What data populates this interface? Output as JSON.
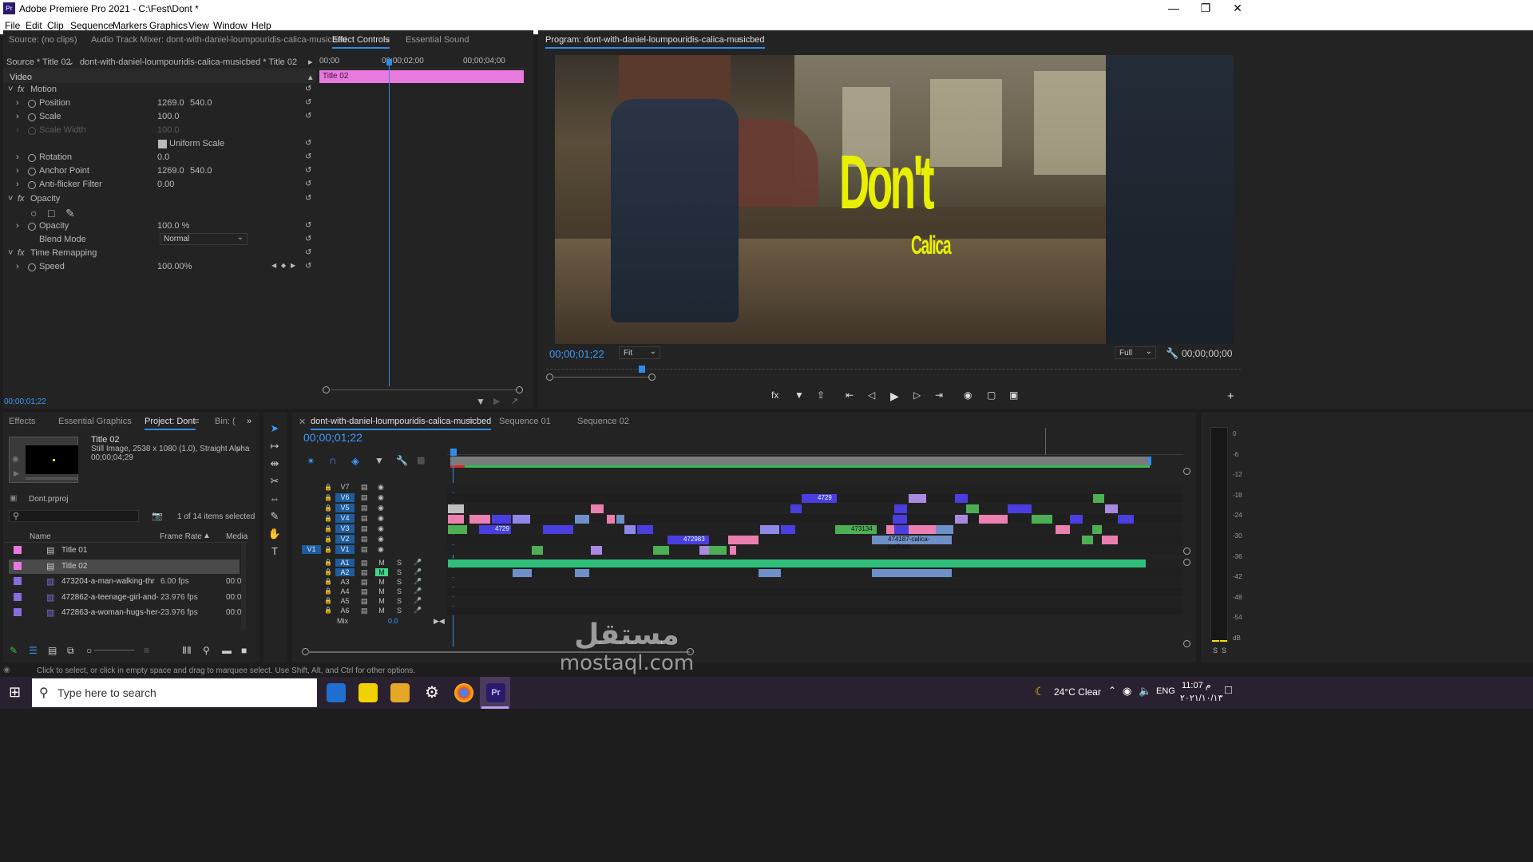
{
  "window": {
    "title": "Adobe Premiere Pro 2021 - C:\\Fest\\Dont *",
    "app_icon": "Pr",
    "controls": [
      "minimize-icon",
      "maximize-icon",
      "close-icon"
    ]
  },
  "menu": [
    "File",
    "Edit",
    "Clip",
    "Sequence",
    "Markers",
    "Graphics",
    "View",
    "Window",
    "Help"
  ],
  "top_left_tabs": {
    "source": "Source: (no clips)",
    "mixer": "Audio Track Mixer: dont-with-daniel-loumpouridis-calica-musicbed",
    "effect_controls": "Effect Controls",
    "essential_sound": "Essential Sound"
  },
  "effect_controls": {
    "source_label": "Source * Title 02",
    "seq_label": "dont-with-daniel-loumpouridis-calica-musicbed * Title 02",
    "ruler": [
      "00;00",
      "00;00;02;00",
      "00;00;04;00"
    ],
    "clip_name": "Title 02",
    "video_label": "Video",
    "timecode": "00;00;01;22",
    "rows": [
      {
        "name": "Motion",
        "fx": true
      },
      {
        "name": "Position",
        "v1": "1269.0",
        "v2": "540.0"
      },
      {
        "name": "Scale",
        "v1": "100.0"
      },
      {
        "name": "Scale Width",
        "v1": "100.0",
        "disabled": true
      },
      {
        "name": "Uniform Scale",
        "checkbox": true
      },
      {
        "name": "Rotation",
        "v1": "0.0"
      },
      {
        "name": "Anchor Point",
        "v1": "1269.0",
        "v2": "540.0"
      },
      {
        "name": "Anti-flicker Filter",
        "v1": "0.00"
      },
      {
        "name": "Opacity",
        "fx": true
      },
      {
        "name": "Opacity",
        "v1": "100.0 %"
      },
      {
        "name": "Blend Mode",
        "select": "Normal"
      },
      {
        "name": "Time Remapping",
        "fx": true
      },
      {
        "name": "Speed",
        "v1": "100.00%"
      }
    ]
  },
  "program": {
    "tab": "Program: dont-with-daniel-loumpouridis-calica-musicbed",
    "timecode_left": "00;00;01;22",
    "fit": "Fit",
    "quality": "Full",
    "timecode_right": "00;00;00;00",
    "title_text": "Don't",
    "subtitle_text": "Calica",
    "controls": [
      "fx-icon",
      "marker-icon",
      "lift-icon",
      "goto-in-icon",
      "step-back-icon",
      "play-icon",
      "step-forward-icon",
      "goto-out-icon",
      "camera-icon",
      "safe-margins-icon",
      "compare-icon",
      "add-icon"
    ]
  },
  "project": {
    "tabs": [
      "Effects",
      "Essential Graphics",
      "Project: Dont",
      "Bin: ("
    ],
    "preview_name": "Title 02",
    "preview_info": "Still Image, 2538 x 1080 (1.0), Straight Alpha",
    "preview_duration": "00;00;04;29",
    "file_name": "Dont.prproj",
    "selected_count": "1 of 14 items selected",
    "columns": [
      "Name",
      "Frame Rate",
      "Media"
    ],
    "items": [
      {
        "name": "Title 01",
        "fps": "",
        "media": "",
        "color": "#e87adf",
        "selected": false
      },
      {
        "name": "Title 02",
        "fps": "",
        "media": "",
        "color": "#e87adf",
        "selected": true
      },
      {
        "name": "473204-a-man-walking-thr",
        "fps": "6.00 fps",
        "media": "00:0",
        "color": "#8a6ce0",
        "selected": false
      },
      {
        "name": "472862-a-teenage-girl-and-",
        "fps": "23.976 fps",
        "media": "00:0",
        "color": "#8a6ce0",
        "selected": false
      },
      {
        "name": "472863-a-woman-hugs-her-",
        "fps": "23.976 fps",
        "media": "00:0",
        "color": "#8a6ce0",
        "selected": false
      }
    ]
  },
  "timeline": {
    "tabs": [
      "dont-with-daniel-loumpouridis-calica-musicbed",
      "Sequence 01",
      "Sequence 02"
    ],
    "timecode": "00;00;01;22",
    "video_tracks": [
      "V7",
      "V6",
      "V5",
      "V4",
      "V3",
      "V2",
      "V1"
    ],
    "audio_tracks": [
      "A1",
      "A2",
      "A3",
      "A4",
      "A5",
      "A6"
    ],
    "mix_label": "Mix",
    "mix_value": "0.0",
    "clip_labels": [
      "4729",
      "4729",
      "473134",
      "472983",
      "474187-calica-perform"
    ],
    "v1_label": "V1"
  },
  "meter": {
    "ticks": [
      "0",
      "-6",
      "-12",
      "-18",
      "-24",
      "-30",
      "-36",
      "-42",
      "-48",
      "-54",
      "dB"
    ],
    "solo": [
      "S",
      "S"
    ]
  },
  "status": "Click to select, or click in empty space and drag to marquee select. Use Shift, Alt, and Ctrl for other options.",
  "watermark": {
    "arabic": "مستقل",
    "latin": "mostaql.com"
  },
  "taskbar": {
    "search_placeholder": "Type here to search",
    "weather": "24°C  Clear",
    "lang": "ENG",
    "time": "11:07 م",
    "date": "٢٠٢١/١٠/١٣"
  }
}
